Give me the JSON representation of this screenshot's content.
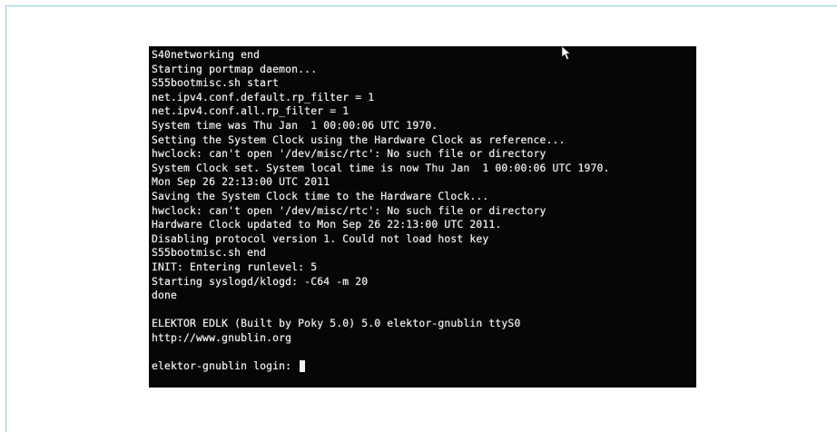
{
  "terminal": {
    "lines": [
      "S40networking end",
      "Starting portmap daemon...",
      "S55bootmisc.sh start",
      "net.ipv4.conf.default.rp_filter = 1",
      "net.ipv4.conf.all.rp_filter = 1",
      "System time was Thu Jan  1 00:00:06 UTC 1970.",
      "Setting the System Clock using the Hardware Clock as reference...",
      "hwclock: can't open '/dev/misc/rtc': No such file or directory",
      "System Clock set. System local time is now Thu Jan  1 00:00:06 UTC 1970.",
      "Mon Sep 26 22:13:00 UTC 2011",
      "Saving the System Clock time to the Hardware Clock...",
      "hwclock: can't open '/dev/misc/rtc': No such file or directory",
      "Hardware Clock updated to Mon Sep 26 22:13:00 UTC 2011.",
      "Disabling protocol version 1. Could not load host key",
      "S55bootmisc.sh end",
      "INIT: Entering runlevel: 5",
      "Starting syslogd/klogd: -C64 -m 20",
      "done",
      "",
      "ELEKTOR EDLK (Built by Poky 5.0) 5.0 elektor-gnublin ttyS0",
      "http://www.gnublin.org",
      ""
    ],
    "prompt": "elektor-gnublin login: "
  },
  "icons": {
    "pointer": "mouse-pointer-icon",
    "cursor": "text-cursor-icon"
  },
  "colors": {
    "terminal_background": "#060606",
    "terminal_text": "#e8e8e8",
    "frame_border": "#8fd0e6"
  }
}
